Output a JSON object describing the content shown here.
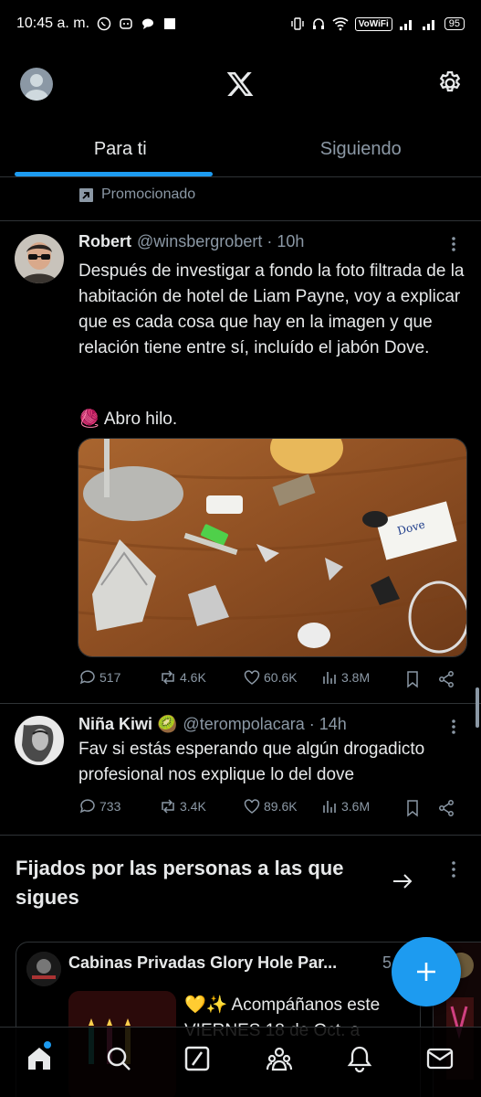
{
  "status_bar": {
    "time": "10:45 a. m.",
    "vowifi": "VoWiFi",
    "battery": "95"
  },
  "header": {
    "avatar_icon": "default-avatar-icon",
    "logo_icon": "x-logo",
    "settings_icon": "gear-icon"
  },
  "tabs": [
    {
      "label": "Para ti",
      "active": true
    },
    {
      "label": "Siguiendo",
      "active": false
    }
  ],
  "promoted": {
    "label": "Promocionado"
  },
  "tweets": [
    {
      "name": "Robert",
      "handle": "@winsbergrobert",
      "time": "10h",
      "text": "Después de investigar a fondo la foto filtrada de la habitación de hotel de Liam Payne, voy a explicar que es cada cosa que hay en la imagen y que relación tiene entre sí, incluído el jabón Dove.",
      "text2": "🧶 Abro hilo.",
      "media_label": "Dove",
      "replies": "517",
      "retweets": "4.6K",
      "likes": "60.6K",
      "views": "3.8M"
    },
    {
      "name": "Niña Kiwi 🥝",
      "handle": "@terompolacara",
      "time": "14h",
      "text": "Fav si estás esperando que algún drogadicto profesional nos explique lo del dove",
      "replies": "733",
      "retweets": "3.4K",
      "likes": "89.6K",
      "views": "3.6M"
    }
  ],
  "pinned": {
    "title": "Fijados por las personas a las que sigues",
    "card": {
      "name": "Cabinas Privadas Glory Hole Par...",
      "time": "5",
      "text": "💛✨ Acompáñanos este VIERNES 18 de Oct. a"
    }
  },
  "bottom_nav": [
    "home-icon",
    "search-icon",
    "grok-icon",
    "communities-icon",
    "notifications-icon",
    "messages-icon"
  ],
  "colors": {
    "accent": "#1d9bf0",
    "muted": "#8b98a5",
    "border": "#2f3336"
  }
}
